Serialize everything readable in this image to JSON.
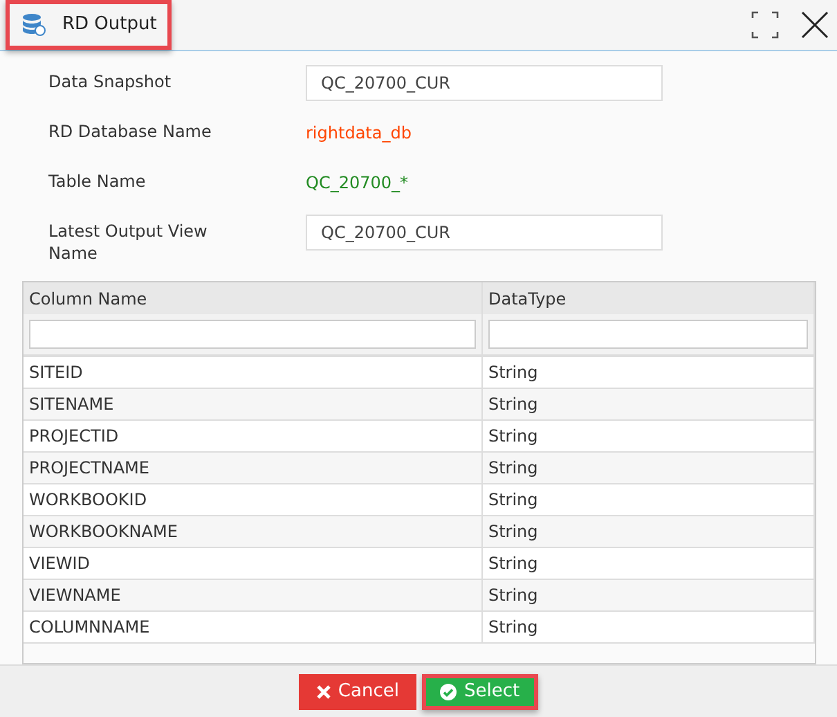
{
  "dialog": {
    "title": "RD Output",
    "title_highlighted": true
  },
  "fields": [
    {
      "kind": "input",
      "label": "Data Snapshot",
      "value": "QC_20700_CUR"
    },
    {
      "kind": "text",
      "label": "RD Database Name",
      "value": "rightdata_db",
      "color": "#ff4500"
    },
    {
      "kind": "text",
      "label": "Table Name",
      "value": "QC_20700_*",
      "color": "#228b22"
    },
    {
      "kind": "input",
      "label": "Latest Output View Name",
      "value": "QC_20700_CUR"
    }
  ],
  "table": {
    "columns": [
      "Column Name",
      "DataType"
    ],
    "rows": [
      [
        "SITEID",
        "String"
      ],
      [
        "SITENAME",
        "String"
      ],
      [
        "PROJECTID",
        "String"
      ],
      [
        "PROJECTNAME",
        "String"
      ],
      [
        "WORKBOOKID",
        "String"
      ],
      [
        "WORKBOOKNAME",
        "String"
      ],
      [
        "VIEWID",
        "String"
      ],
      [
        "VIEWNAME",
        "String"
      ],
      [
        "COLUMNNAME",
        "String"
      ]
    ]
  },
  "buttons": [
    {
      "kind": "cancel",
      "label": "Cancel",
      "highlighted": false
    },
    {
      "kind": "select",
      "label": "Select",
      "highlighted": true
    }
  ]
}
